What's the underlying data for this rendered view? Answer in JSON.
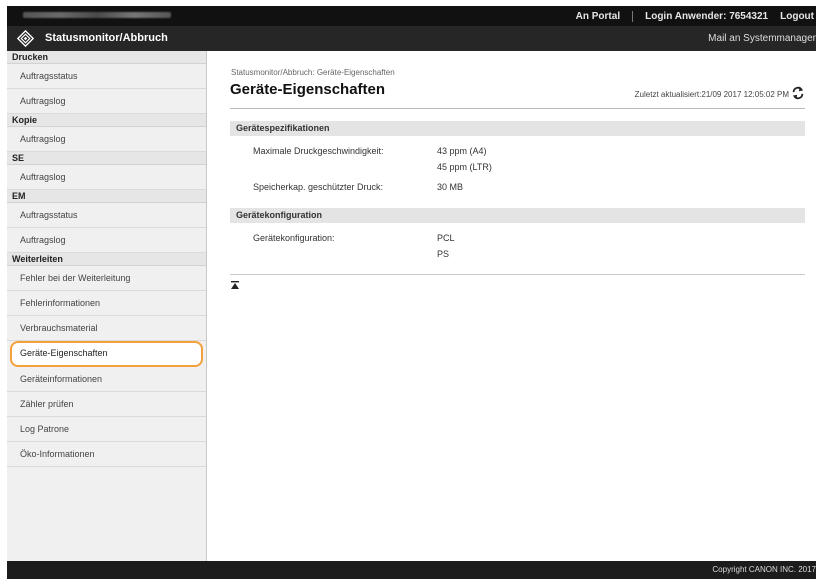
{
  "topbar": {
    "portal_link": "An Portal",
    "login_label": "Login Anwender:",
    "login_user": "7654321",
    "logout_link": "Logout"
  },
  "titlebar": {
    "title": "Statusmonitor/Abbruch",
    "mail_admin": "Mail an Systemmanager"
  },
  "sidebar": {
    "sections": [
      {
        "header": "Drucken",
        "items": [
          "Auftragsstatus",
          "Auftragslog"
        ]
      },
      {
        "header": "Kopie",
        "items": [
          "Auftragslog"
        ]
      },
      {
        "header": "SE",
        "items": [
          "Auftragslog"
        ]
      },
      {
        "header": "EM",
        "items": [
          "Auftragsstatus",
          "Auftragslog"
        ]
      },
      {
        "header": "Weiterleiten",
        "items": [
          "Fehler bei der Weiterleitung",
          "Fehlerinformationen",
          "Verbrauchsmaterial",
          "Geräte-Eigenschaften",
          "Geräteinformationen",
          "Zähler prüfen",
          "Log Patrone",
          "Öko-Informationen"
        ]
      }
    ],
    "selected": "Geräte-Eigenschaften"
  },
  "main": {
    "breadcrumb": "Statusmonitor/Abbruch: Geräte-Eigenschaften",
    "title": "Geräte-Eigenschaften",
    "last_updated": "Zuletzt aktualisiert:21/09 2017 12:05:02 PM",
    "sections": [
      {
        "header": "Gerätespezifikationen",
        "rows": [
          {
            "label": "Maximale Druckgeschwindigkeit:",
            "values": [
              "43 ppm (A4)",
              "45 ppm (LTR)"
            ]
          },
          {
            "label": "Speicherkap. geschützter Druck:",
            "values": [
              "30 MB"
            ]
          }
        ]
      },
      {
        "header": "Gerätekonfiguration",
        "rows": [
          {
            "label": "Gerätekonfiguration:",
            "values": [
              "PCL",
              "PS"
            ]
          }
        ]
      }
    ]
  },
  "footer": {
    "copyright": "Copyright CANON INC. 2017"
  },
  "icons": {
    "logo": "canon-diamond-logo-icon",
    "refresh": "refresh-icon",
    "to_top": "back-to-top-icon"
  },
  "colors": {
    "accent_selected": "#f3a13a",
    "topbar": "#111111",
    "titlebar": "#262626"
  }
}
